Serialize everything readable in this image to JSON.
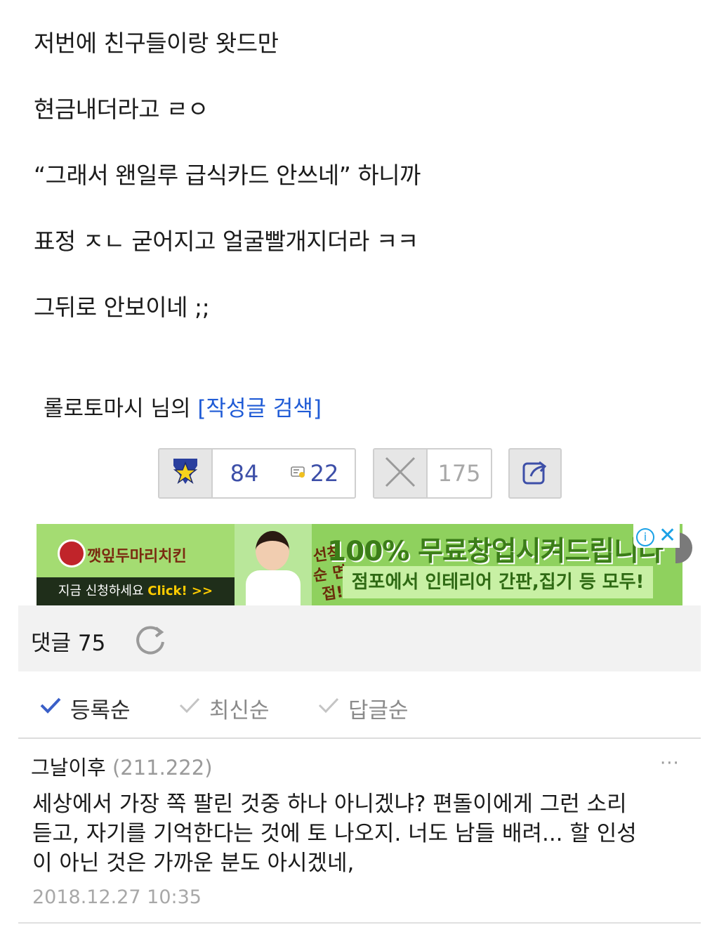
{
  "post": {
    "lines": [
      "저번에 친구들이랑 왓드만",
      "현금내더라고 ㄹㅇ",
      "“그래서 왠일루 급식카드 안쓰네” 하니까",
      "표정 ㅈㄴ 굳어지고 얼굴빨개지더라 ㅋㅋ",
      "그뒤로 안보이네 ;;"
    ],
    "author_prefix": "롤로토마시 님의",
    "author_search_link": "[작성글 검색]"
  },
  "actions": {
    "recommend_count": "84",
    "comment_count": "22",
    "dislike_count": "175"
  },
  "ad": {
    "brand": "깻잎두마리치킨",
    "cta_prefix": "지금 신청하세요",
    "cta_click": "Click! >>",
    "badge": "선착순 면접!",
    "headline": "100% 무료창업시켜드립니다",
    "subline": "점포에서 인테리어 간판,집기 등 모두!",
    "info_icon": "i",
    "close_icon": "✕"
  },
  "comments": {
    "title": "댓글 75",
    "sort_tabs": [
      {
        "label": "등록순",
        "active": true
      },
      {
        "label": "최신순",
        "active": false
      },
      {
        "label": "답글순",
        "active": false
      }
    ],
    "items": [
      {
        "author": "그날이후",
        "ip": "(211.222)",
        "more": "···",
        "body_lines": [
          "세상에서 가장 쪽 팔린 것중 하나 아니겠냐? 편돌이에게 그런 소리",
          "듣고, 자기를 기억한다는 것에 토 나오지. 너도 남들 배려...  할 인성",
          "이 아닌 것은 가까운 분도 아시겠네,"
        ],
        "date": "2018.12.27 10:35"
      }
    ]
  },
  "colors": {
    "link_blue": "#1f5bd6",
    "count_blue": "#3d4fa8",
    "ad_green": "#8fd15e",
    "check_blue": "#3a5fc8"
  }
}
